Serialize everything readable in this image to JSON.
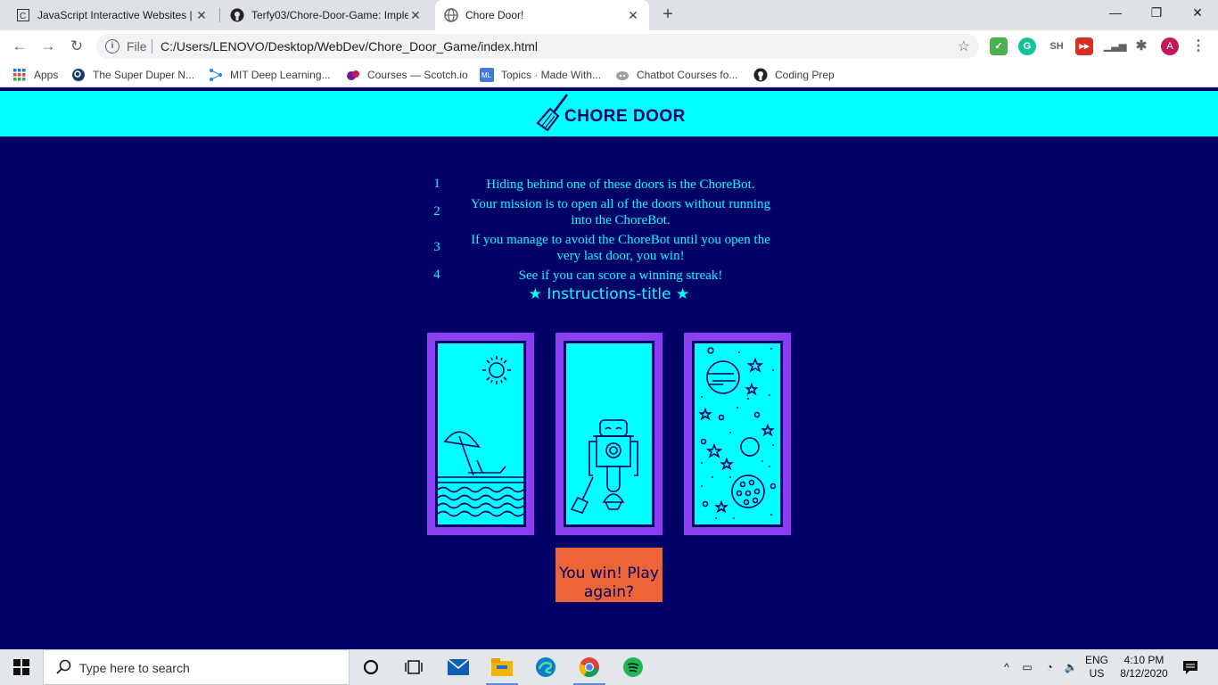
{
  "browser": {
    "tabs": [
      {
        "title": "JavaScript Interactive Websites | C",
        "icon": "codecademy-icon",
        "active": false
      },
      {
        "title": "Terfy03/Chore-Door-Game: Imple",
        "icon": "github-icon",
        "active": false
      },
      {
        "title": "Chore Door!",
        "icon": "globe-icon",
        "active": true
      }
    ],
    "omnibox": {
      "scheme_label": "File",
      "url": "C:/Users/LENOVO/Desktop/WebDev/Chore_Door_Game/index.html"
    },
    "extensions": [
      "SH"
    ],
    "profile_initial": "A",
    "bookmarks": [
      {
        "label": "Apps",
        "icon": "apps-grid-icon"
      },
      {
        "label": "The Super Duper N...",
        "icon": "magnifier-icon"
      },
      {
        "label": "MIT Deep Learning...",
        "icon": "network-icon"
      },
      {
        "label": "Courses — Scotch.io",
        "icon": "scotch-icon"
      },
      {
        "label": "Topics · Made With...",
        "icon": "ml-icon"
      },
      {
        "label": "Chatbot Courses fo...",
        "icon": "chatbot-icon"
      },
      {
        "label": "Coding Prep",
        "icon": "github-icon"
      }
    ]
  },
  "page": {
    "header_title": "CHORE DOOR",
    "instructions": [
      {
        "num": "1",
        "text": "Hiding behind one of these doors is the ChoreBot."
      },
      {
        "num": "2",
        "text": "Your mission is to open all of the doors without running into the ChoreBot."
      },
      {
        "num": "3",
        "text": "If you manage to avoid the ChoreBot until you open the very last door, you win!"
      },
      {
        "num": "4",
        "text": "See if you can score a winning streak!"
      }
    ],
    "instructions_title": "★ Instructions-title ★",
    "doors": [
      {
        "scene": "beach"
      },
      {
        "scene": "robot"
      },
      {
        "scene": "space"
      }
    ],
    "start_button_label": "You win! Play again?"
  },
  "taskbar": {
    "search_placeholder": "Type here to search",
    "language": "ENG",
    "region": "US",
    "time": "4:10 PM",
    "date": "8/12/2020"
  },
  "colors": {
    "page_bg": "#000066",
    "header_bg": "#00ffff",
    "door_frame": "#8a3ff0",
    "button_bg": "#eb6536"
  }
}
